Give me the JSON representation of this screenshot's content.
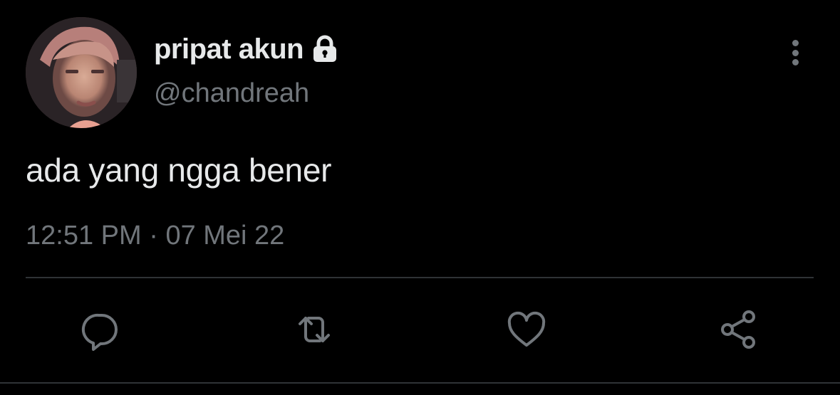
{
  "tweet": {
    "display_name": "pripat akun",
    "handle": "@chandreah",
    "text": "ada yang ngga bener",
    "time": "12:51 PM",
    "separator": "·",
    "date": "07 Mei 22",
    "protected": true
  },
  "icons": {
    "lock": "lock-icon",
    "more": "more-vertical-icon",
    "reply": "reply-icon",
    "retweet": "retweet-icon",
    "like": "heart-icon",
    "share": "share-icon"
  },
  "colors": {
    "background": "#000000",
    "primary_text": "#e7e9ea",
    "secondary_text": "#71767b",
    "divider": "#2f3336"
  }
}
